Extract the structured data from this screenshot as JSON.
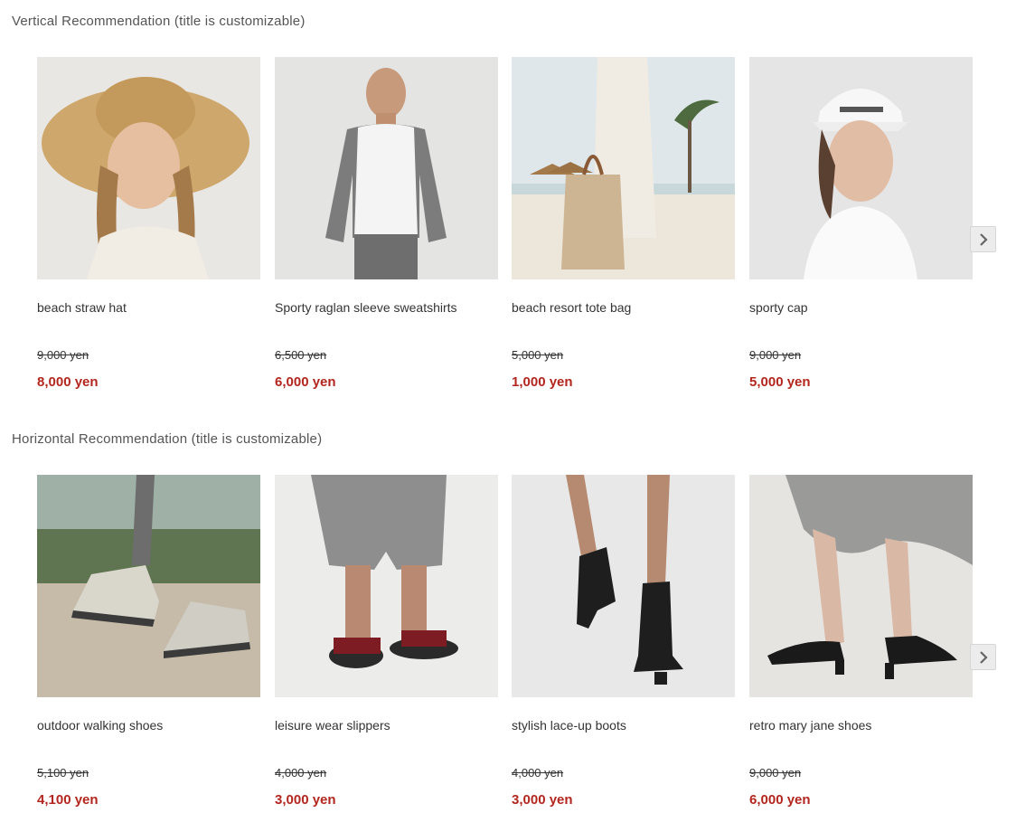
{
  "sections": [
    {
      "title": "Vertical Recommendation (title is customizable)",
      "next_icon": "chevron-right-icon",
      "items": [
        {
          "name": "beach straw hat",
          "old_price": "9,000 yen",
          "price": "8,000 yen",
          "image": "woman-straw-hat-photo"
        },
        {
          "name": "Sporty raglan sleeve sweatshirts",
          "old_price": "6,500 yen",
          "price": "6,000 yen",
          "image": "man-raglan-sweatshirt-photo"
        },
        {
          "name": "beach resort tote bag",
          "old_price": "5,000 yen",
          "price": "1,000 yen",
          "image": "beach-tote-bag-photo"
        },
        {
          "name": "sporty cap",
          "old_price": "9,000 yen",
          "price": "5,000 yen",
          "image": "woman-white-cap-photo"
        }
      ]
    },
    {
      "title": "Horizontal Recommendation (title is customizable)",
      "next_icon": "chevron-right-icon",
      "items": [
        {
          "name": "outdoor walking shoes",
          "old_price": "5,100 yen",
          "price": "4,100 yen",
          "image": "hiking-shoes-photo"
        },
        {
          "name": "leisure wear slippers",
          "old_price": "4,000 yen",
          "price": "3,000 yen",
          "image": "slippers-photo"
        },
        {
          "name": "stylish lace-up boots",
          "old_price": "4,000 yen",
          "price": "3,000 yen",
          "image": "lace-up-boots-photo"
        },
        {
          "name": "retro mary jane shoes",
          "old_price": "9,000 yen",
          "price": "6,000 yen",
          "image": "mary-jane-shoes-photo"
        }
      ]
    }
  ],
  "colors": {
    "sale_price": "#b3261e",
    "title_text": "#555555"
  }
}
